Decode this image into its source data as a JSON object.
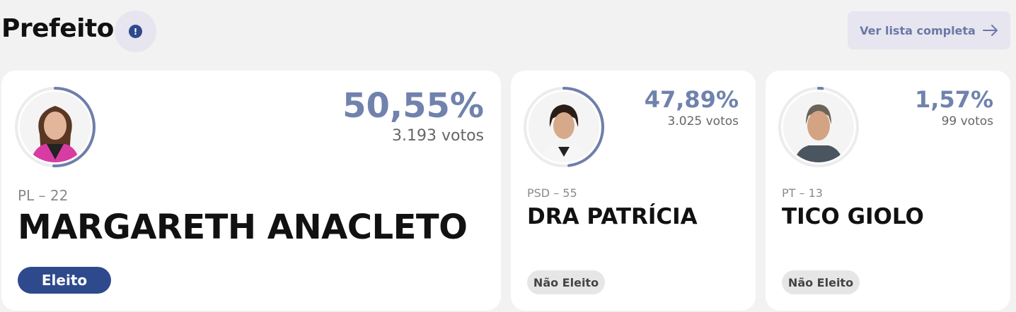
{
  "header": {
    "title": "Prefeito",
    "info_icon": "!",
    "list_button": "Ver lista completa"
  },
  "candidates": [
    {
      "party": "PL – 22",
      "name": "MARGARETH ANACLETO",
      "percent": "50,55%",
      "votes": "3.193 votos",
      "status": "Eleito",
      "share": 0.5055
    },
    {
      "party": "PSD – 55",
      "name": "DRA PATRÍCIA",
      "percent": "47,89%",
      "votes": "3.025 votos",
      "status": "Não Eleito",
      "share": 0.4789
    },
    {
      "party": "PT – 13",
      "name": "TICO GIOLO",
      "percent": "1,57%",
      "votes": "99 votos",
      "status": "Não Eleito",
      "share": 0.0157
    }
  ],
  "colors": {
    "accent": "#2e4a8d",
    "percent": "#7082ad",
    "ring": "#6f7fab",
    "background": "#f2f2f2"
  }
}
